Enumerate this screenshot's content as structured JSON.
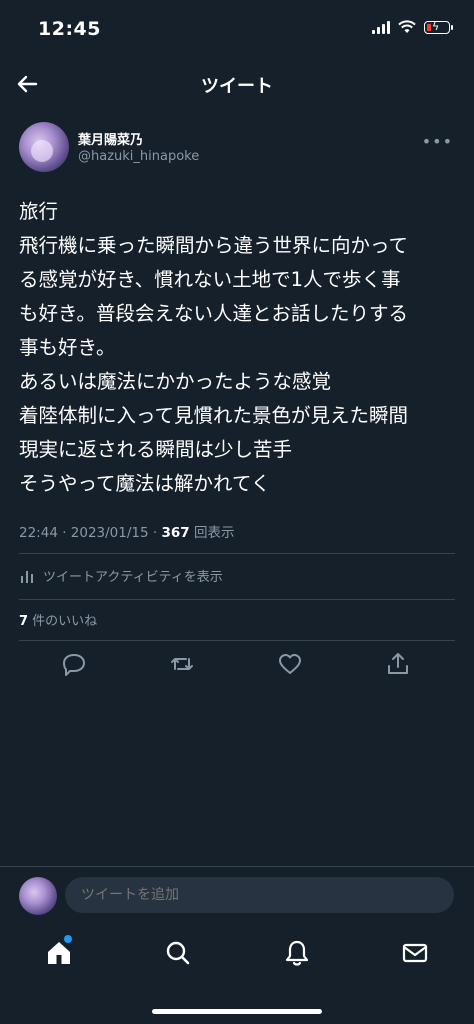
{
  "status_bar": {
    "time": "12:45"
  },
  "nav": {
    "title": "ツイート"
  },
  "author": {
    "display_name": "葉月陽菜乃",
    "handle": "@hazuki_hinapoke"
  },
  "tweet": {
    "lines": [
      "旅行",
      "飛行機に乗った瞬間から違う世界に向かって",
      "る感覚が好き、慣れない土地で1人で歩く事",
      "も好き。普段会えない人達とお話したりする",
      "事も好き。",
      "あるいは魔法にかかったような感覚",
      "着陸体制に入って見慣れた景色が見えた瞬間",
      "現実に返される瞬間は少し苦手",
      "そうやって魔法は解かれてく"
    ],
    "timestamp": "22:44 · 2023/01/15 · ",
    "views_count": "367",
    "views_label": " 回表示"
  },
  "activity": {
    "label": "ツイートアクティビティを表示"
  },
  "likes": {
    "count": "7",
    "label": " 件のいいね"
  },
  "reply": {
    "placeholder": "ツイートを追加"
  },
  "colors": {
    "background": "#15202b",
    "secondary_text": "#8b98a5",
    "accent": "#1d9bf0",
    "divider": "#38444d"
  },
  "icons": [
    "back-arrow-icon",
    "more-icon",
    "activity-chart-icon",
    "reply-icon",
    "retweet-icon",
    "like-icon",
    "share-icon",
    "home-icon",
    "search-icon",
    "notifications-icon",
    "messages-icon"
  ]
}
